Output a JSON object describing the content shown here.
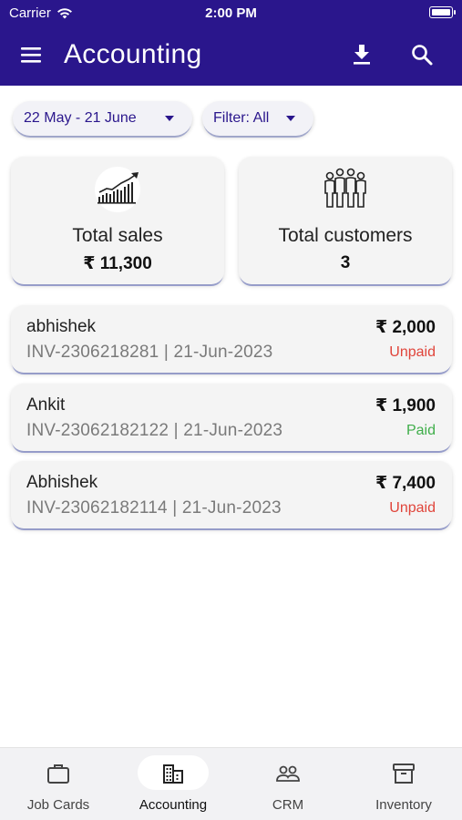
{
  "status_bar": {
    "carrier": "Carrier",
    "time": "2:00 PM"
  },
  "app_bar": {
    "title": "Accounting",
    "menu_icon": "hamburger-menu-icon",
    "download_icon": "download-icon",
    "search_icon": "search-icon",
    "color": "#2a168c"
  },
  "filters": {
    "date_range": "22 May - 21 June",
    "filter": "Filter: All"
  },
  "summary": {
    "sales": {
      "label": "Total sales",
      "value": "₹ 11,300",
      "icon": "sales-growth-chart-icon"
    },
    "customers": {
      "label": "Total customers",
      "value": "3",
      "icon": "customers-group-icon"
    }
  },
  "invoices": [
    {
      "name": "abhishek",
      "meta": "INV-2306218281 | 21-Jun-2023",
      "amount": "₹ 2,000",
      "status": "Unpaid"
    },
    {
      "name": "Ankit",
      "meta": "INV-23062182122 | 21-Jun-2023",
      "amount": "₹ 1,900",
      "status": "Paid"
    },
    {
      "name": "Abhishek",
      "meta": "INV-23062182114 | 21-Jun-2023",
      "amount": "₹ 7,400",
      "status": "Unpaid"
    }
  ],
  "status_colors": {
    "unpaid": "#e0443a",
    "paid": "#3fae4a"
  },
  "bottom_nav": {
    "active": "Accounting",
    "items": [
      {
        "label": "Job Cards",
        "icon": "briefcase-icon"
      },
      {
        "label": "Accounting",
        "icon": "building-icon"
      },
      {
        "label": "CRM",
        "icon": "people-icon"
      },
      {
        "label": "Inventory",
        "icon": "archive-box-icon"
      }
    ]
  }
}
